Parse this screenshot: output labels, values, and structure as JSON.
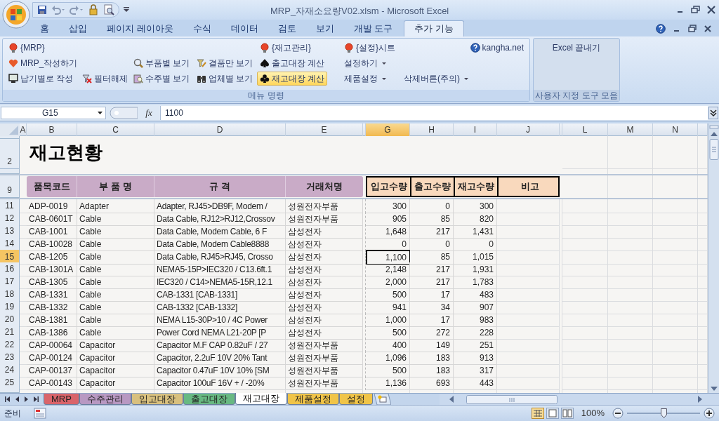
{
  "window": {
    "title": "MRP_자재소요량V02.xlsm  -  Microsoft Excel"
  },
  "ribbon_tabs": [
    {
      "label": "홈",
      "selected": false
    },
    {
      "label": "삽입",
      "selected": false
    },
    {
      "label": "페이지 레이아웃",
      "selected": false
    },
    {
      "label": "수식",
      "selected": false
    },
    {
      "label": "데이터",
      "selected": false
    },
    {
      "label": "검토",
      "selected": false
    },
    {
      "label": "보기",
      "selected": false
    },
    {
      "label": "개발 도구",
      "selected": false
    },
    {
      "label": "추가 기능",
      "selected": true
    }
  ],
  "ribbon_groups": [
    {
      "label": "메뉴 명령",
      "rows": [
        [
          {
            "kind": "bulb",
            "label": "{MRP}",
            "dropdown": false,
            "highlighted": false
          },
          "",
          "",
          "",
          {
            "kind": "bulb",
            "label": "{재고관리}",
            "dropdown": false,
            "highlighted": false
          },
          {
            "kind": "bulb",
            "label": "{설정}시트",
            "dropdown": false,
            "highlighted": false
          },
          {
            "kind": "help",
            "label": "kangha.net",
            "dropdown": false,
            "highlighted": false
          }
        ],
        [
          {
            "kind": "heart",
            "label": "MRP_작성하기",
            "dropdown": false,
            "highlighted": false
          },
          "",
          {
            "kind": "magnifier",
            "label": "부품별 보기",
            "dropdown": false,
            "highlighted": false
          },
          {
            "kind": "funnel",
            "label": "결품만 보기",
            "dropdown": false,
            "highlighted": false
          },
          {
            "kind": "spade",
            "label": "출고대장 계산",
            "dropdown": false,
            "highlighted": false
          },
          {
            "kind": "text",
            "label": "설정하기",
            "dropdown": true,
            "highlighted": false
          },
          ""
        ],
        [
          {
            "kind": "monitor",
            "label": "납기별로 작성",
            "dropdown": false,
            "highlighted": false
          },
          {
            "kind": "funnel-x",
            "label": "필터해제",
            "dropdown": false,
            "highlighted": false
          },
          {
            "kind": "clipboard",
            "label": "수주별 보기",
            "dropdown": false,
            "highlighted": false
          },
          {
            "kind": "binoculars",
            "label": "업체별 보기",
            "dropdown": false,
            "highlighted": false
          },
          {
            "kind": "club",
            "label": "재고대장 계산",
            "dropdown": false,
            "highlighted": true
          },
          {
            "kind": "text",
            "label": "제품설정",
            "dropdown": true,
            "highlighted": false
          },
          {
            "kind": "text",
            "label": "삭제버튼(주의)",
            "dropdown": true,
            "highlighted": false
          }
        ]
      ]
    },
    {
      "label": "사용자 지정 도구 모음",
      "rows": [
        [
          {
            "kind": "text",
            "label": "Excel 끝내기",
            "dropdown": false,
            "highlighted": false
          }
        ]
      ]
    }
  ],
  "formula_bar": {
    "name_box": "G15",
    "function_label": "fx",
    "value": "1100"
  },
  "sheet": {
    "columns": [
      {
        "label": "A",
        "selected": false
      },
      {
        "label": "B",
        "selected": false
      },
      {
        "label": "C",
        "selected": false
      },
      {
        "label": "D",
        "selected": false
      },
      {
        "label": "E",
        "selected": false
      },
      {
        "selected": false
      },
      {
        "label": "G",
        "selected": true
      },
      {
        "label": "H",
        "selected": false
      },
      {
        "label": "I",
        "selected": false
      },
      {
        "label": "J",
        "selected": false
      },
      {
        "selected": false
      },
      {
        "label": "L",
        "selected": false
      },
      {
        "label": "M",
        "selected": false
      },
      {
        "label": "N",
        "selected": false
      }
    ],
    "title_row": "2",
    "title": "재고현황",
    "header_row": "9",
    "headers": [
      "품목코드",
      "부 품 명",
      "규 격",
      "거래처명"
    ],
    "qty_headers": [
      "입고수량",
      "출고수량",
      "재고수량",
      "비고"
    ],
    "rows": [
      {
        "row": "11",
        "code": "ADP-0019",
        "name": "Adapter",
        "spec": "Adapter, RJ45>DB9F, Modem /",
        "vendor": "성원전자부품",
        "in": "300",
        "out": "0",
        "stock": "300",
        "selected": false
      },
      {
        "row": "12",
        "code": "CAB-0601T",
        "name": "Cable",
        "spec": "Data Cable, RJ12>RJ12,Crossov",
        "vendor": "성원전자부품",
        "in": "905",
        "out": "85",
        "stock": "820",
        "selected": false
      },
      {
        "row": "13",
        "code": "CAB-1001",
        "name": "Cable",
        "spec": "Data Cable, Modem Cable, 6 F",
        "vendor": "삼성전자",
        "in": "1,648",
        "out": "217",
        "stock": "1,431",
        "selected": false
      },
      {
        "row": "14",
        "code": "CAB-10028",
        "name": "Cable",
        "spec": "Data Cable, Modem Cable8888",
        "vendor": "삼성전자",
        "in": "0",
        "out": "0",
        "stock": "0",
        "selected": false
      },
      {
        "row": "15",
        "code": "CAB-1205",
        "name": "Cable",
        "spec": "Data Cable, RJ45>RJ45, Crosso",
        "vendor": "삼성전자",
        "in": "1,100",
        "out": "85",
        "stock": "1,015",
        "selected": true
      },
      {
        "row": "16",
        "code": "CAB-1301A",
        "name": "Cable",
        "spec": "NEMA5-15P>IEC320 / C13.6ft.1",
        "vendor": "삼성전자",
        "in": "2,148",
        "out": "217",
        "stock": "1,931",
        "selected": false
      },
      {
        "row": "17",
        "code": "CAB-1305",
        "name": "Cable",
        "spec": "IEC320 / C14>NEMA5-15R,12.1",
        "vendor": "삼성전자",
        "in": "2,000",
        "out": "217",
        "stock": "1,783",
        "selected": false
      },
      {
        "row": "18",
        "code": "CAB-1331",
        "name": "Cable",
        "spec": "CAB-1331 [CAB-1331]",
        "vendor": "삼성전자",
        "in": "500",
        "out": "17",
        "stock": "483",
        "selected": false
      },
      {
        "row": "19",
        "code": "CAB-1332",
        "name": "Cable",
        "spec": "CAB-1332 [CAB-1332]",
        "vendor": "삼성전자",
        "in": "941",
        "out": "34",
        "stock": "907",
        "selected": false
      },
      {
        "row": "20",
        "code": "CAB-1381",
        "name": "Cable",
        "spec": "NEMA L15-30P>10 / 4C Power",
        "vendor": "삼성전자",
        "in": "1,000",
        "out": "17",
        "stock": "983",
        "selected": false
      },
      {
        "row": "21",
        "code": "CAB-1386",
        "name": "Cable",
        "spec": "Power Cord NEMA L21-20P [P",
        "vendor": "삼성전자",
        "in": "500",
        "out": "272",
        "stock": "228",
        "selected": false
      },
      {
        "row": "22",
        "code": "CAP-00064",
        "name": "Capacitor",
        "spec": "Capacitor M.F CAP 0.82uF / 27",
        "vendor": "성원전자부품",
        "in": "400",
        "out": "149",
        "stock": "251",
        "selected": false
      },
      {
        "row": "23",
        "code": "CAP-00124",
        "name": "Capacitor",
        "spec": "Capacitor, 2.2uF 10V 20% Tant",
        "vendor": "성원전자부품",
        "in": "1,096",
        "out": "183",
        "stock": "913",
        "selected": false
      },
      {
        "row": "24",
        "code": "CAP-00137",
        "name": "Capacitor",
        "spec": "Capacitor 0.47uF 10V 10% [SM",
        "vendor": "성원전자부품",
        "in": "500",
        "out": "183",
        "stock": "317",
        "selected": false
      },
      {
        "row": "25",
        "code": "CAP-00143",
        "name": "Capacitor",
        "spec": "Capacitor 100uF 16V + / -20%",
        "vendor": "성원전자부품",
        "in": "1,136",
        "out": "693",
        "stock": "443",
        "selected": false
      }
    ]
  },
  "sheet_tabs": [
    {
      "label": "MRP",
      "color": "#d9646a",
      "selected": false
    },
    {
      "label": "수주관리",
      "color": "#b898c2",
      "selected": false
    },
    {
      "label": "입고대장",
      "color": "#d8c07e",
      "selected": false
    },
    {
      "label": "출고대장",
      "color": "#68b982",
      "selected": false
    },
    {
      "label": "재고대장",
      "color": "#ffffff",
      "selected": true
    },
    {
      "label": "제품설정",
      "color": "#f0c448",
      "selected": false
    },
    {
      "label": "설정",
      "color": "#f0c448",
      "selected": false
    }
  ],
  "status_bar": {
    "text": "준비",
    "zoom": "100%",
    "zoom_slider": {
      "level": 0.5
    }
  }
}
